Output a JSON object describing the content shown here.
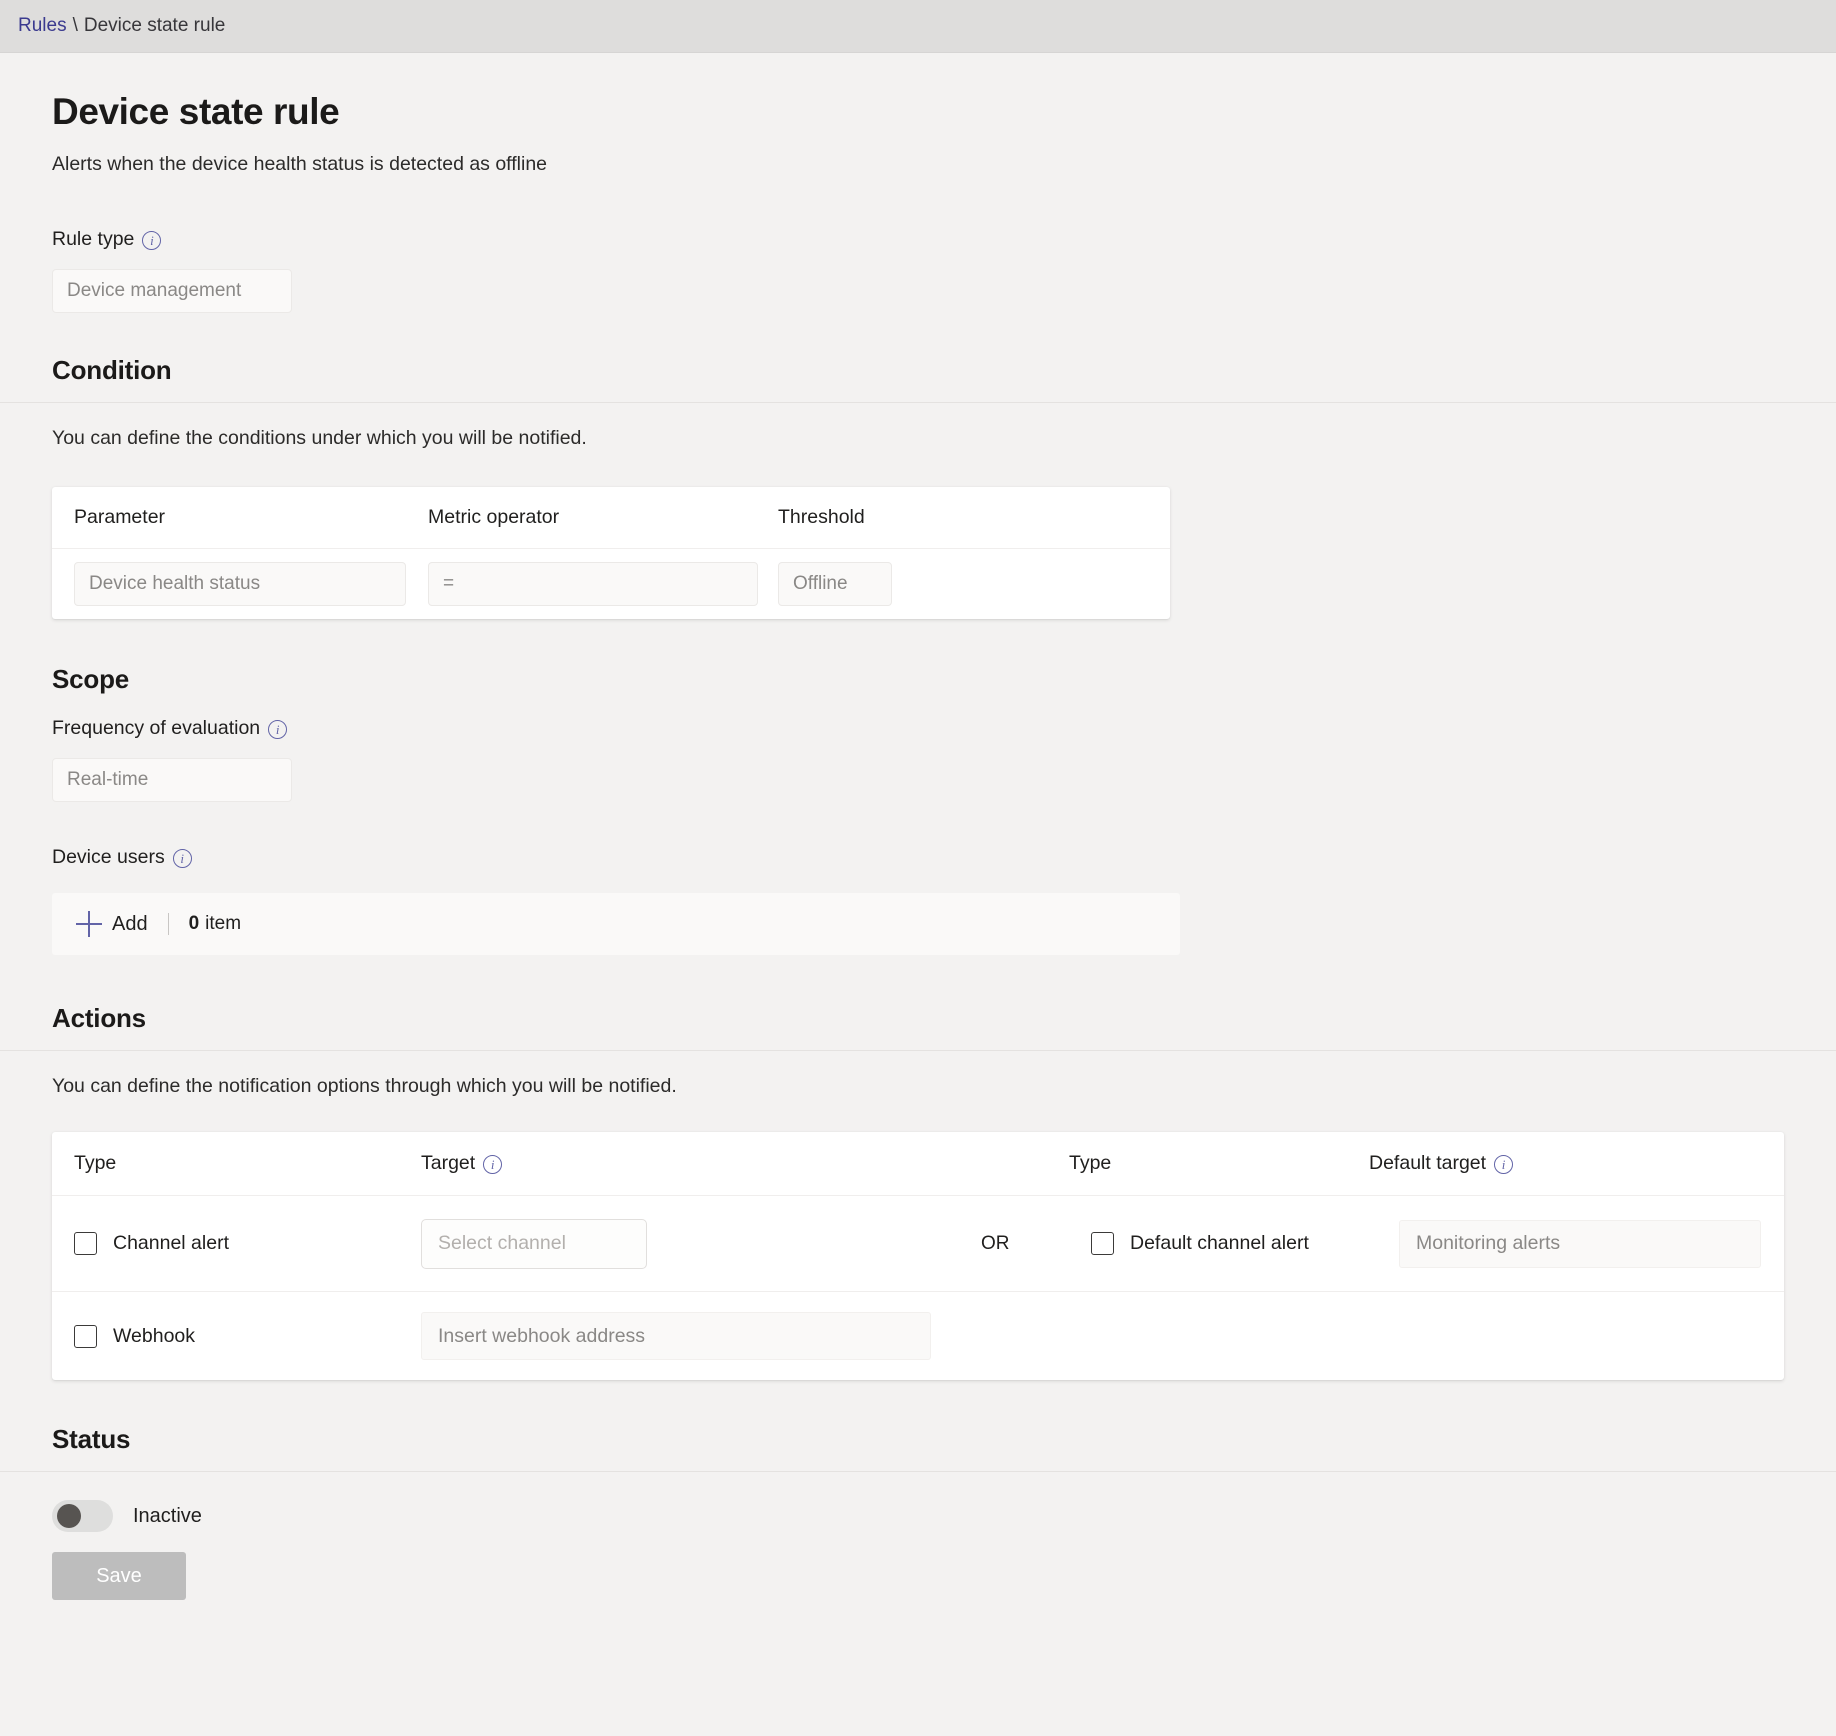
{
  "breadcrumb": {
    "root": "Rules",
    "separator": "\\",
    "current": "Device state rule"
  },
  "header": {
    "title": "Device state rule",
    "subtitle": "Alerts when the device health status is detected as offline"
  },
  "rule_type": {
    "label": "Rule type",
    "info_icon": "info-icon",
    "value": "Device management"
  },
  "condition": {
    "title": "Condition",
    "description": "You can define the conditions under which you will be notified.",
    "columns": [
      "Parameter",
      "Metric operator",
      "Threshold"
    ],
    "row": {
      "parameter": "Device health status",
      "metric_operator": "=",
      "threshold": "Offline"
    }
  },
  "scope": {
    "title": "Scope",
    "frequency": {
      "label": "Frequency of evaluation",
      "info_icon": "info-icon",
      "value": "Real-time"
    },
    "device_users": {
      "label": "Device users",
      "info_icon": "info-icon",
      "add_icon": "plus-icon",
      "add_label": "Add",
      "count": "0",
      "count_unit": "item"
    }
  },
  "actions": {
    "title": "Actions",
    "description": "You can define the notification options through which you will be notified.",
    "columns": {
      "type_left": "Type",
      "target": "Target",
      "target_info_icon": "info-icon",
      "type_right": "Type",
      "default_target": "Default target",
      "default_target_info_icon": "info-icon"
    },
    "rows": [
      {
        "left_label": "Channel alert",
        "left_checked": false,
        "left_field_placeholder": "Select channel",
        "conjunction": "OR",
        "right_label": "Default channel alert",
        "right_checked": false,
        "right_field_value": "Monitoring alerts"
      },
      {
        "left_label": "Webhook",
        "left_checked": false,
        "left_field_placeholder": "Insert webhook address"
      }
    ]
  },
  "status": {
    "title": "Status",
    "toggle_state": "off",
    "toggle_label": "Inactive",
    "save_label": "Save",
    "save_enabled": false
  },
  "colors": {
    "page_background": "#f3f2f1",
    "topbar_background": "#dedddc",
    "accent": "#6264a7",
    "link": "#3b3a8f",
    "card_background": "#ffffff",
    "subtle_field": "#faf9f8",
    "disabled_button": "#bdbdbd",
    "toggle_knob": "#575451"
  }
}
